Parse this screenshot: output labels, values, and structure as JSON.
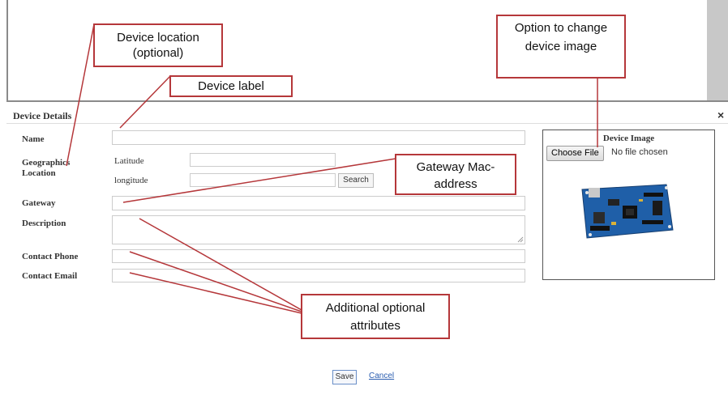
{
  "dialog": {
    "title": "Device Details",
    "close": "×"
  },
  "form": {
    "name_label": "Name",
    "geo_label": "Geographics Location",
    "latitude_label": "Latitude",
    "longitude_label": "longitude",
    "search_label": "Search",
    "gateway_label": "Gateway",
    "description_label": "Description",
    "phone_label": "Contact Phone",
    "email_label": "Contact Email"
  },
  "image_panel": {
    "title": "Device Image",
    "choose_file": "Choose File",
    "no_file": "No file chosen"
  },
  "actions": {
    "save": "Save",
    "cancel": "Cancel"
  },
  "callouts": {
    "location": "Device location (optional)",
    "label": "Device label",
    "image": "Option to change device image",
    "gateway": "Gateway Mac-address",
    "additional": "Additional optional attributes"
  },
  "colors": {
    "callout_border": "#b5373a",
    "link": "#2a5db0"
  }
}
